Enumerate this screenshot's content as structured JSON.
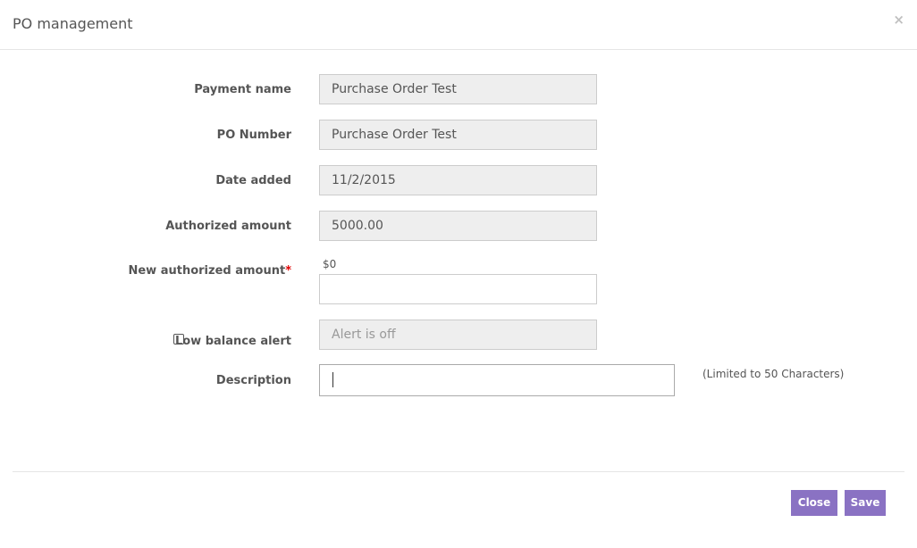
{
  "modal": {
    "title": "PO management",
    "close_glyph": "×"
  },
  "form": {
    "payment_name": {
      "label": "Payment name",
      "value": "Purchase Order Test"
    },
    "po_number": {
      "label": "PO Number",
      "value": "Purchase Order Test"
    },
    "date_added": {
      "label": "Date added",
      "value": "11/2/2015"
    },
    "authorized_amount": {
      "label": "Authorized amount",
      "value": "5000.00"
    },
    "new_authorized_amount": {
      "label": "New authorized amount",
      "required_mark": "*",
      "hint": "$0",
      "value": ""
    },
    "low_balance_alert": {
      "label": "Low balance alert",
      "checked": false,
      "placeholder": "Alert is off"
    },
    "description": {
      "label": "Description",
      "value": "",
      "limit_note": "(Limited to 50 Characters)"
    }
  },
  "footer": {
    "close_label": "Close",
    "save_label": "Save"
  },
  "colors": {
    "button": "#8a72c3",
    "readonly_field": "#eeeeee",
    "required": "#e00000"
  }
}
